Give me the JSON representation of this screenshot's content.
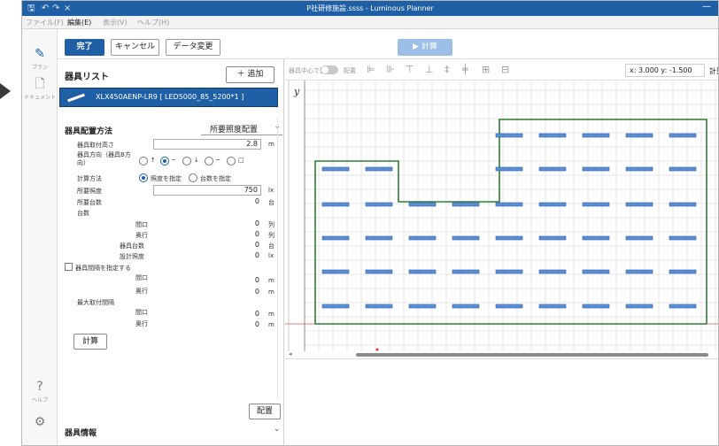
{
  "window": {
    "title": "P社研修施設.ssss - Luminous Planner",
    "minimize": "—"
  },
  "menu": {
    "file": "ファイル(F)",
    "edit": "編集(E)",
    "view": "表示(V)",
    "help": "ヘルプ(H)"
  },
  "rail": {
    "plan": "プラン",
    "document": "ドキュメント",
    "help": "ヘルプ"
  },
  "toolbar": {
    "done": "完了",
    "cancel": "キャンセル",
    "data_change": "データ変更",
    "calc": "▶ 計算"
  },
  "fixture_list": {
    "title": "器具リスト",
    "add": "＋ 追加",
    "selected_item": "XLX450AENP-LR9 [ LED5000_85_5200*1 ]"
  },
  "placement": {
    "title": "器具配置方法",
    "method": "所要照度配置",
    "mount_height_label": "器具取付高さ",
    "mount_height_value": "2.8",
    "mount_height_unit": "m",
    "direction_label": "器具方向（器具B方向）",
    "direction_options": [
      "↑",
      "─",
      "↓",
      "─",
      "□"
    ],
    "calc_method_label": "計算方法",
    "calc_method_options": [
      "照度を指定",
      "台数を指定"
    ],
    "required_lux_label": "所要照度",
    "required_lux_value": "750",
    "required_lux_unit": "lx",
    "required_count_label": "所要台数",
    "required_count_value": "0",
    "required_count_unit": "台",
    "count_section": "台数",
    "frontage_label": "間口",
    "frontage_value": "0",
    "frontage_unit": "列",
    "depth_label": "奥行",
    "depth_value": "0",
    "depth_unit": "列",
    "fixture_count_label": "器具台数",
    "fixture_count_value": "0",
    "fixture_count_unit": "台",
    "design_lux_label": "設計照度",
    "design_lux_value": "0",
    "design_lux_unit": "lx",
    "spacing_check_label": "器具間隔を指定する",
    "spacing_frontage_label": "間口",
    "spacing_frontage_value": "0",
    "spacing_frontage_unit": "m",
    "spacing_depth_label": "奥行",
    "spacing_depth_value": "0",
    "spacing_depth_unit": "m",
    "max_spacing_section": "最大取付間隔",
    "max_frontage_label": "間口",
    "max_frontage_value": "0",
    "max_frontage_unit": "m",
    "max_depth_label": "奥行",
    "max_depth_value": "0",
    "max_depth_unit": "m",
    "calc_button": "計算",
    "place_button": "配置",
    "fixture_info": "器具情報"
  },
  "canvas_toolbar": {
    "align_label": "器具中心で整列",
    "layout_label": "配置",
    "coords": "x: 3.000  y: -1.500",
    "calc_area": "計算範囲"
  },
  "canvas": {
    "y_axis_label": "y",
    "room_outline_color": "#2f7d32",
    "fixture_color": "#5b8fd6",
    "fixture_rows": [
      {
        "label": "row-1",
        "count": 5
      },
      {
        "label": "row-2",
        "count": 7
      },
      {
        "label": "row-3",
        "count": 9
      },
      {
        "label": "row-4",
        "count": 9
      },
      {
        "label": "row-5",
        "count": 9
      },
      {
        "label": "row-6",
        "count": 9
      }
    ]
  }
}
